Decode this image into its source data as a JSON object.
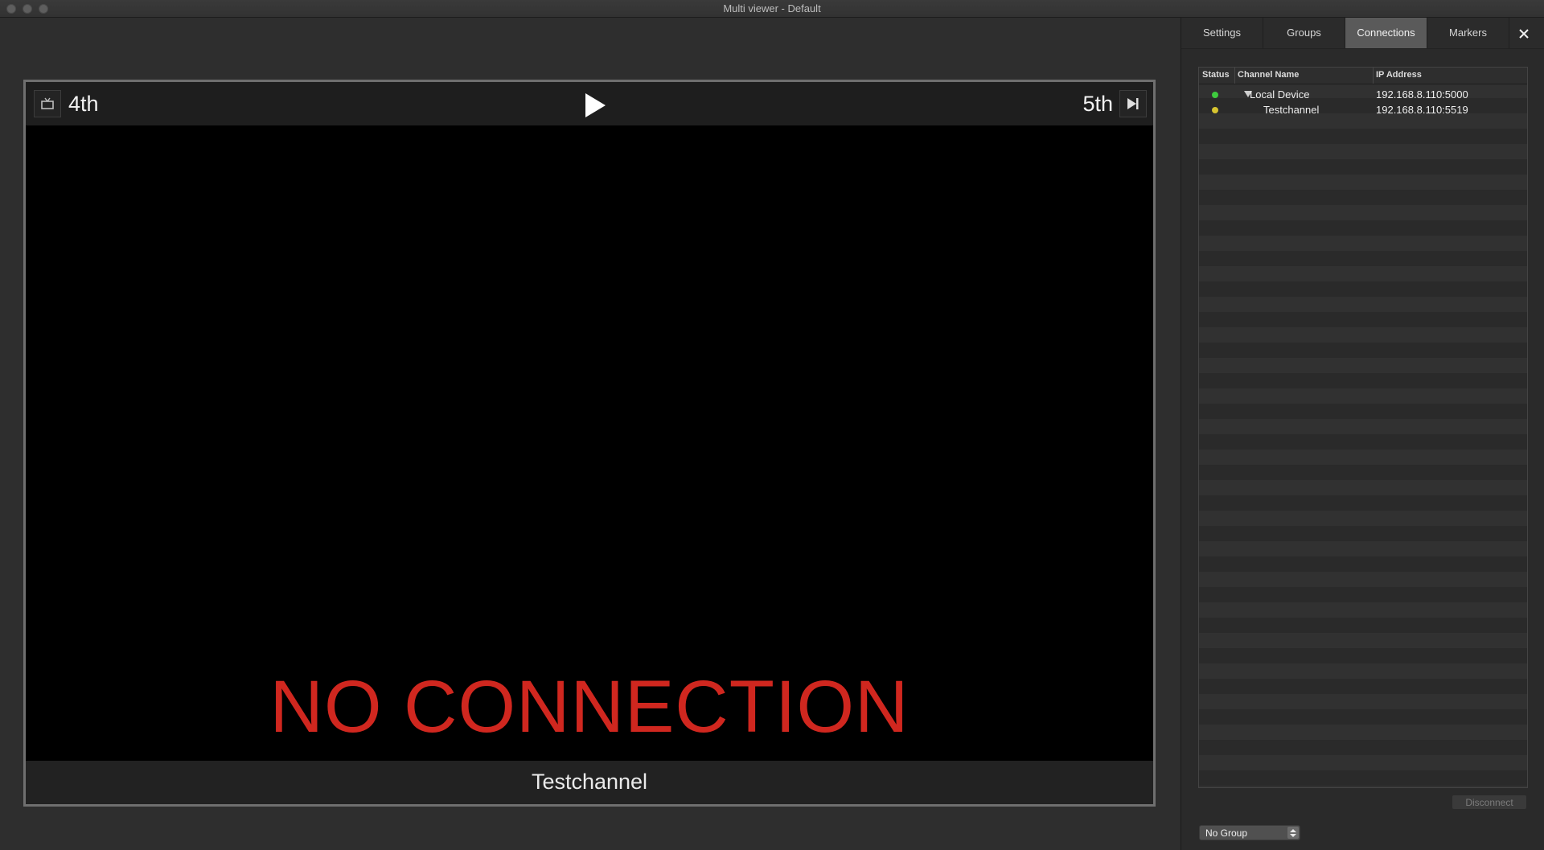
{
  "window": {
    "title": "Multi viewer - Default"
  },
  "viewer": {
    "left_label": "4th",
    "right_label": "5th",
    "status_text": "NO CONNECTION",
    "channel_name": "Testchannel",
    "status_color": "#d0271f"
  },
  "side_panel": {
    "tabs": [
      {
        "label": "Settings"
      },
      {
        "label": "Groups"
      },
      {
        "label": "Connections",
        "active": true
      },
      {
        "label": "Markers"
      }
    ],
    "table": {
      "columns": [
        "Status",
        "Channel Name",
        "IP Address"
      ],
      "rows": [
        {
          "status_color": "#3ecb3e",
          "name": "Local Device",
          "ip": "192.168.8.110:5000",
          "expanded": true
        },
        {
          "status_color": "#d6c430",
          "name": "Testchannel",
          "ip": "192.168.8.110:5519"
        }
      ]
    },
    "disconnect_label": "Disconnect",
    "group_select": {
      "value": "No Group"
    }
  }
}
